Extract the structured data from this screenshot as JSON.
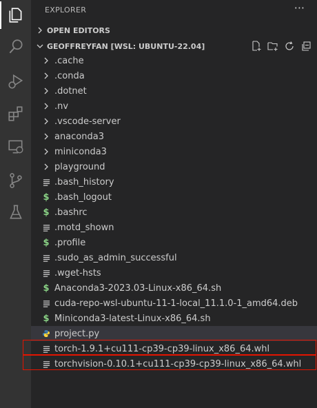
{
  "activity_bar": {
    "items": [
      {
        "name": "explorer",
        "icon": "files-icon"
      },
      {
        "name": "search",
        "icon": "search-icon"
      },
      {
        "name": "run-debug",
        "icon": "run-debug-icon"
      },
      {
        "name": "extensions",
        "icon": "extensions-icon"
      },
      {
        "name": "remote-explorer",
        "icon": "remote-explorer-icon"
      },
      {
        "name": "source-control",
        "icon": "source-control-icon"
      },
      {
        "name": "testing",
        "icon": "beaker-icon"
      }
    ]
  },
  "explorer": {
    "title": "EXPLORER",
    "more": "···",
    "open_editors": "OPEN EDITORS",
    "workspace": "GEOFFREYFAN [WSL: UBUNTU-22.04]",
    "items": [
      {
        "label": ".cache",
        "kind": "folder"
      },
      {
        "label": ".conda",
        "kind": "folder"
      },
      {
        "label": ".dotnet",
        "kind": "folder"
      },
      {
        "label": ".nv",
        "kind": "folder"
      },
      {
        "label": ".vscode-server",
        "kind": "folder"
      },
      {
        "label": "anaconda3",
        "kind": "folder"
      },
      {
        "label": "miniconda3",
        "kind": "folder"
      },
      {
        "label": "playground",
        "kind": "folder"
      },
      {
        "label": ".bash_history",
        "kind": "text"
      },
      {
        "label": ".bash_logout",
        "kind": "shell"
      },
      {
        "label": ".bashrc",
        "kind": "shell"
      },
      {
        "label": ".motd_shown",
        "kind": "text"
      },
      {
        "label": ".profile",
        "kind": "shell"
      },
      {
        "label": ".sudo_as_admin_successful",
        "kind": "text"
      },
      {
        "label": ".wget-hsts",
        "kind": "text"
      },
      {
        "label": "Anaconda3-2023.03-Linux-x86_64.sh",
        "kind": "shell"
      },
      {
        "label": "cuda-repo-wsl-ubuntu-11-1-local_11.1.0-1_amd64.deb",
        "kind": "text"
      },
      {
        "label": "Miniconda3-latest-Linux-x86_64.sh",
        "kind": "shell"
      },
      {
        "label": "project.py",
        "kind": "python",
        "selected": true
      },
      {
        "label": "torch-1.9.1+cu111-cp39-cp39-linux_x86_64.whl",
        "kind": "text",
        "highlighted": true
      },
      {
        "label": "torchvision-0.10.1+cu111-cp39-cp39-linux_x86_64.whl",
        "kind": "text",
        "highlighted": true
      }
    ]
  },
  "colors": {
    "activity_bar": "#333333",
    "sidebar": "#252526",
    "text": "#cccccc",
    "selected_row": "#37373d",
    "shell_icon": "#89d185",
    "python_icon": "#3c78aa",
    "highlight_border": "#e51400"
  }
}
